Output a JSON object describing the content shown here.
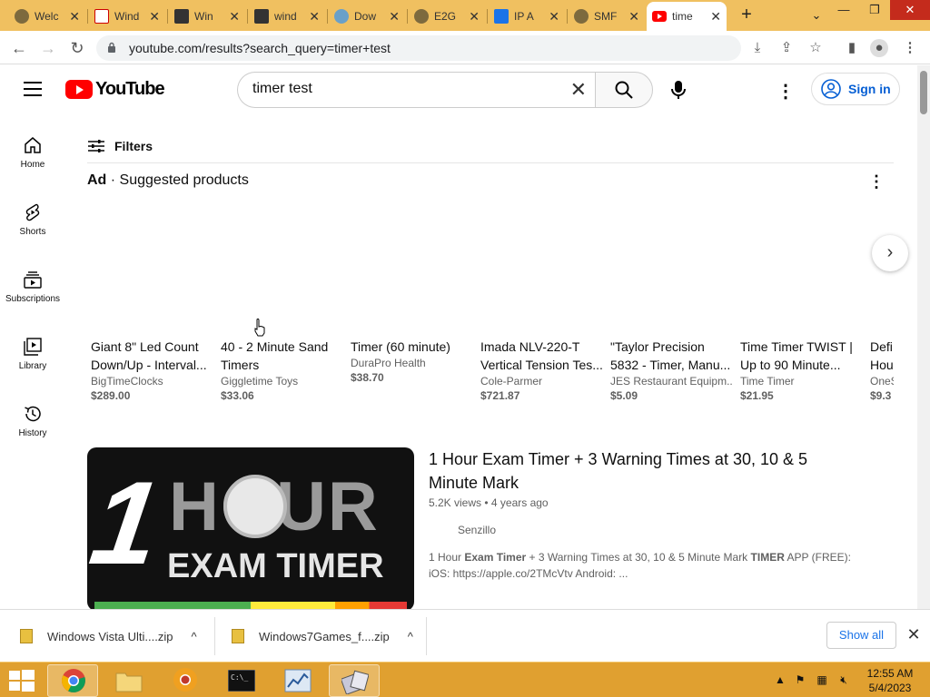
{
  "browser": {
    "tabs": [
      {
        "title": "Welc"
      },
      {
        "title": "Wind"
      },
      {
        "title": "Win"
      },
      {
        "title": "wind"
      },
      {
        "title": "Dow"
      },
      {
        "title": "E2G"
      },
      {
        "title": "IP A"
      },
      {
        "title": "SMF"
      },
      {
        "title": "time"
      }
    ],
    "url": "youtube.com/results?search_query=timer+test"
  },
  "header": {
    "logo_text": "YouTube",
    "search_value": "timer test",
    "signin_label": "Sign in"
  },
  "sidebar": {
    "items": [
      {
        "label": "Home"
      },
      {
        "label": "Shorts"
      },
      {
        "label": "Subscriptions"
      },
      {
        "label": "Library"
      },
      {
        "label": "History"
      }
    ]
  },
  "filters_label": "Filters",
  "ad": {
    "prefix": "Ad",
    "separator": " · ",
    "label": "Suggested products"
  },
  "products": [
    {
      "title": "Giant 8\" Led Count Down/Up - Interval...",
      "seller": "BigTimeClocks",
      "price": "$289.00"
    },
    {
      "title": "40 - 2 Minute Sand Timers",
      "seller": "Giggletime Toys",
      "price": "$33.06"
    },
    {
      "title": "Timer (60 minute)",
      "seller": "DuraPro Health",
      "price": "$38.70"
    },
    {
      "title": "Imada NLV-220-T Vertical Tension Tes...",
      "seller": "Cole-Parmer",
      "price": "$721.87"
    },
    {
      "title": "\"Taylor Precision 5832 - Timer, Manu...",
      "seller": "JES Restaurant Equipm...",
      "price": "$5.09"
    },
    {
      "title": "Time Timer TWIST | Up to 90 Minute...",
      "seller": "Time Timer",
      "price": "$21.95"
    },
    {
      "title": "Defi Hou",
      "seller": "OneS",
      "price": "$9.3"
    }
  ],
  "video": {
    "thumb_one": "1",
    "thumb_hour": "HOUR",
    "thumb_exam": "EXAM TIMER",
    "title": "1 Hour Exam Timer + 3 Warning Times at 30, 10 & 5 Minute Mark",
    "meta": "5.2K views • 4 years ago",
    "channel": "Senzillo",
    "desc_1": "1 Hour ",
    "desc_b1": "Exam Timer",
    "desc_2": " + 3 Warning Times at 30, 10 & 5 Minute Mark ",
    "desc_b2": "TIMER",
    "desc_3": " APP (FREE): iOS: https://apple.co/2TMcVtv Android: ..."
  },
  "downloads": {
    "items": [
      {
        "name": "Windows Vista Ulti....zip"
      },
      {
        "name": "Windows7Games_f....zip"
      }
    ],
    "show_all": "Show all"
  },
  "taskbar": {
    "time": "12:55 AM",
    "date": "5/4/2023"
  },
  "colors": {
    "taskbar": "#e0a030",
    "tabstrip": "#f0c060",
    "youtube_red": "#ff0000",
    "link_blue": "#065fd4"
  }
}
